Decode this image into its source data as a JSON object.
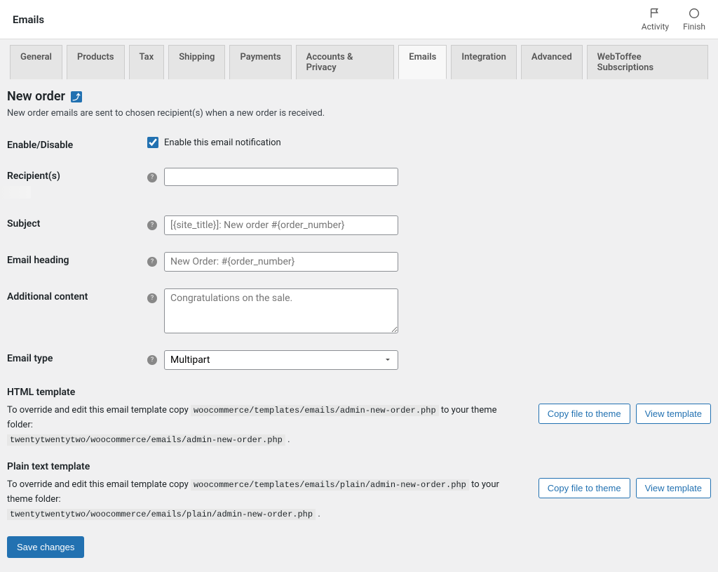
{
  "header": {
    "title": "Emails",
    "activity": "Activity",
    "finish": "Finish"
  },
  "tabs": [
    {
      "label": "General",
      "active": false
    },
    {
      "label": "Products",
      "active": false
    },
    {
      "label": "Tax",
      "active": false
    },
    {
      "label": "Shipping",
      "active": false
    },
    {
      "label": "Payments",
      "active": false
    },
    {
      "label": "Accounts & Privacy",
      "active": false
    },
    {
      "label": "Emails",
      "active": true
    },
    {
      "label": "Integration",
      "active": false
    },
    {
      "label": "Advanced",
      "active": false
    },
    {
      "label": "WebToffee Subscriptions",
      "active": false
    }
  ],
  "page": {
    "title": "New order",
    "back_icon": "⤴",
    "description": "New order emails are sent to chosen recipient(s) when a new order is received."
  },
  "form": {
    "enable": {
      "label": "Enable/Disable",
      "checkbox_label": "Enable this email notification",
      "checked": true
    },
    "recipients": {
      "label": "Recipient(s)",
      "value": ""
    },
    "subject": {
      "label": "Subject",
      "placeholder": "[{site_title}]: New order #{order_number}",
      "value": ""
    },
    "heading": {
      "label": "Email heading",
      "placeholder": "New Order: #{order_number}",
      "value": ""
    },
    "additional": {
      "label": "Additional content",
      "placeholder": "Congratulations on the sale.",
      "value": ""
    },
    "type": {
      "label": "Email type",
      "value": "Multipart"
    }
  },
  "templates": {
    "html": {
      "heading": "HTML template",
      "prefix": "To override and edit this email template copy ",
      "src": "woocommerce/templates/emails/admin-new-order.php",
      "mid": " to your theme folder:",
      "dest": "twentytwentytwo/woocommerce/emails/admin-new-order.php",
      "suffix": " ."
    },
    "plain": {
      "heading": "Plain text template",
      "prefix": "To override and edit this email template copy ",
      "src": "woocommerce/templates/emails/plain/admin-new-order.php",
      "mid": " to your theme folder:",
      "dest": "twentytwentytwo/woocommerce/emails/plain/admin-new-order.php",
      "suffix": " ."
    },
    "copy_btn": "Copy file to theme",
    "view_btn": "View template"
  },
  "save": "Save changes"
}
